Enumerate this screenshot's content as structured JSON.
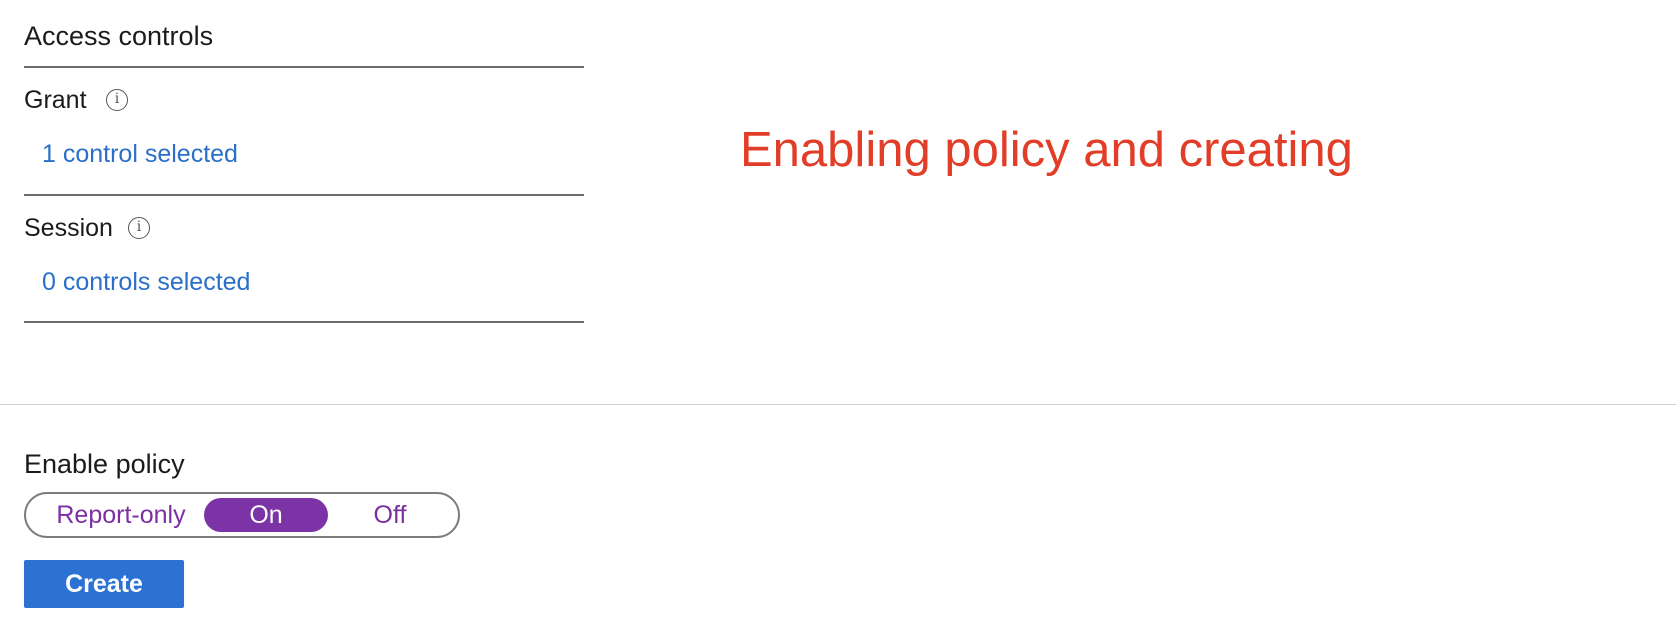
{
  "access_controls": {
    "title": "Access controls",
    "grant": {
      "label": "Grant",
      "link": "1 control selected",
      "info_icon": "info-icon"
    },
    "session": {
      "label": "Session",
      "link": "0 controls selected",
      "info_icon": "info-icon"
    }
  },
  "annotation": {
    "text": "Enabling policy and creating",
    "color": "#e23d28"
  },
  "enable_policy": {
    "label": "Enable policy",
    "options": [
      "Report-only",
      "On",
      "Off"
    ],
    "selected": "On",
    "accent_color": "#7b33a6"
  },
  "create_button": {
    "label": "Create",
    "color": "#2b72d2"
  },
  "link_color": "#2a6fc9"
}
